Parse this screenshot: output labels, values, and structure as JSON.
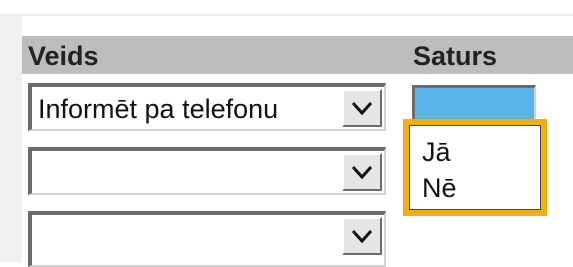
{
  "table": {
    "headers": {
      "veids": "Veids",
      "saturs": "Saturs"
    },
    "rows": [
      {
        "veids_value": "Informēt pa telefonu"
      },
      {
        "veids_value": ""
      },
      {
        "veids_value": ""
      }
    ]
  },
  "dropdown": {
    "options": [
      "Jā",
      "Nē"
    ],
    "highlight_color": "#f5ae0f"
  },
  "colors": {
    "header_bg": "#bdbdbd",
    "saturs_field": "#58b4e6"
  },
  "icons": {
    "select_arrow": "chevron-down-icon"
  }
}
